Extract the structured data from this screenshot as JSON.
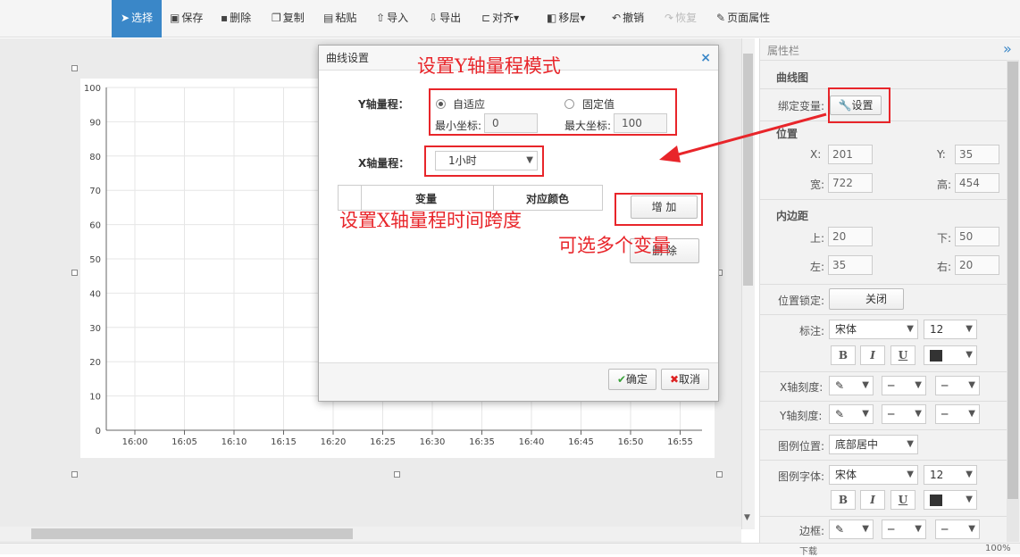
{
  "toolbar": {
    "select": "选择",
    "save": "保存",
    "delete": "删除",
    "copy": "复制",
    "paste": "粘贴",
    "import": "导入",
    "export": "导出",
    "align": "对齐",
    "layer": "移层",
    "undo": "撤销",
    "redo": "恢复",
    "page_props": "页面属性"
  },
  "chart_data": {
    "type": "line",
    "title": "",
    "xlabel": "",
    "ylabel": "",
    "y_ticks": [
      "0",
      "10",
      "20",
      "30",
      "40",
      "50",
      "60",
      "70",
      "80",
      "90",
      "100"
    ],
    "x_ticks": [
      "16:00",
      "16:05",
      "16:10",
      "16:15",
      "16:20",
      "16:25",
      "16:30",
      "16:35",
      "16:40",
      "16:45",
      "16:50",
      "16:55"
    ],
    "ylim": [
      0,
      100
    ],
    "grid": true,
    "series": []
  },
  "dialog": {
    "title": "曲线设置",
    "close": "×",
    "y_range_label": "Y轴量程：",
    "radio_auto": "自适应",
    "radio_fixed": "固定值",
    "min_label": "最小坐标:",
    "min_value": "0",
    "max_label": "最大坐标:",
    "max_value": "100",
    "x_range_label": "X轴量程：",
    "x_range_value": "1小时",
    "col_variable": "变量",
    "col_color": "对应颜色",
    "add_button": "增 加",
    "delete_button": "删 除",
    "ok_button": "确定",
    "cancel_button": "取消"
  },
  "annotations": {
    "y_mode": "设置Y轴量程模式",
    "x_span": "设置X轴量程时间跨度",
    "multi_var": "可选多个变量"
  },
  "panel": {
    "title": "属性栏",
    "collapse": "»",
    "section_name": "曲线图",
    "bind_var_label": "绑定变量:",
    "bind_var_button": "设置",
    "position_title": "位置",
    "x_label": "X:",
    "x_value": "201",
    "y_label": "Y:",
    "y_value": "35",
    "width_label": "宽:",
    "width_value": "722",
    "height_label": "高:",
    "height_value": "454",
    "padding_title": "内边距",
    "top_label": "上:",
    "top_value": "20",
    "bottom_label": "下:",
    "bottom_value": "50",
    "left_label": "左:",
    "left_value": "35",
    "right_label": "右:",
    "right_value": "20",
    "lock_label": "位置锁定:",
    "lock_value": "关闭",
    "label_label": "标注:",
    "font_name": "宋体",
    "font_size": "12",
    "bold": "B",
    "italic": "I",
    "underline": "U",
    "x_tick_label": "X轴刻度:",
    "y_tick_label": "Y轴刻度:",
    "legend_pos_label": "图例位置:",
    "legend_pos_value": "底部居中",
    "legend_font_label": "图例字体:",
    "legend_font_name": "宋体",
    "legend_font_size": "12",
    "border_label": "边框:"
  },
  "status": {
    "download": "下载",
    "zoom": "100%"
  },
  "colors": {
    "accent": "#3a87c8",
    "annotation_red": "#e8252a"
  }
}
